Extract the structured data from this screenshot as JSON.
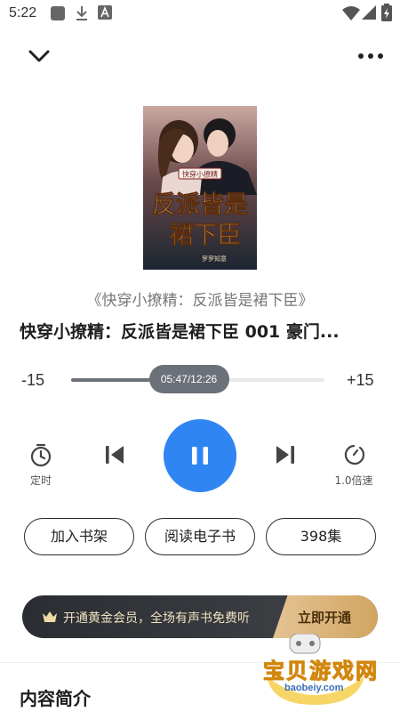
{
  "status_bar": {
    "time": "5:22",
    "icons": [
      "app-square-icon",
      "download-icon",
      "a-letter-icon",
      "wifi-icon",
      "signal-icon",
      "battery-charging-icon"
    ]
  },
  "toolbar": {
    "collapse_icon": "chevron-down-icon",
    "more_icon": "more-horizontal-icon"
  },
  "book": {
    "title": "《快穿小撩精：反派皆是裙下臣》",
    "chapter_title": "快穿小撩精：反派皆是裙下臣 001 豪门...",
    "cover_text": {
      "top_banner": "快穿小撩精",
      "title_line1": "反派皆是",
      "title_line2": "裙下臣",
      "author": "罗罗知意"
    }
  },
  "player": {
    "seek_back": "-15",
    "seek_forward": "+15",
    "position": "05:47",
    "duration": "12:26",
    "time_label": "05:47/12:26",
    "progress_fraction": 0.465,
    "timer_label": "定时",
    "speed_label": "1.0倍速",
    "accent_color": "#2f86f3"
  },
  "actions": {
    "add_shelf": "加入书架",
    "read_ebook": "阅读电子书",
    "episodes": "398集"
  },
  "vip": {
    "text": "开通黄金会员，全场有声书免费听",
    "cta": "立即开通",
    "crown_icon": "crown-icon"
  },
  "intro": {
    "section_title": "内容简介"
  },
  "watermark": {
    "name": "宝贝游戏网",
    "url": "baobeiy.com"
  }
}
